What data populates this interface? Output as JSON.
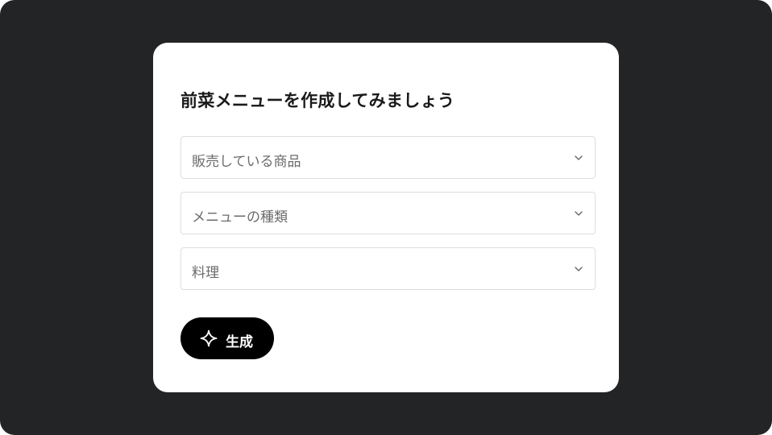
{
  "card": {
    "title": "前菜メニューを作成してみましょう"
  },
  "form": {
    "fields": [
      {
        "value": "販売している商品",
        "icon": "chevron-down-icon"
      },
      {
        "value": "メニューの種類",
        "icon": "chevron-down-icon"
      },
      {
        "value": "料理",
        "icon": "chevron-down-icon"
      }
    ],
    "generate_button": {
      "label": "生成",
      "icon": "sparkle-icon"
    }
  },
  "colors": {
    "background": "#232426",
    "card": "#ffffff",
    "button": "#000000",
    "button_text": "#ffffff",
    "field_border": "#dddddd",
    "field_text": "#6b6b6b",
    "title_text": "#1a1a1a"
  }
}
